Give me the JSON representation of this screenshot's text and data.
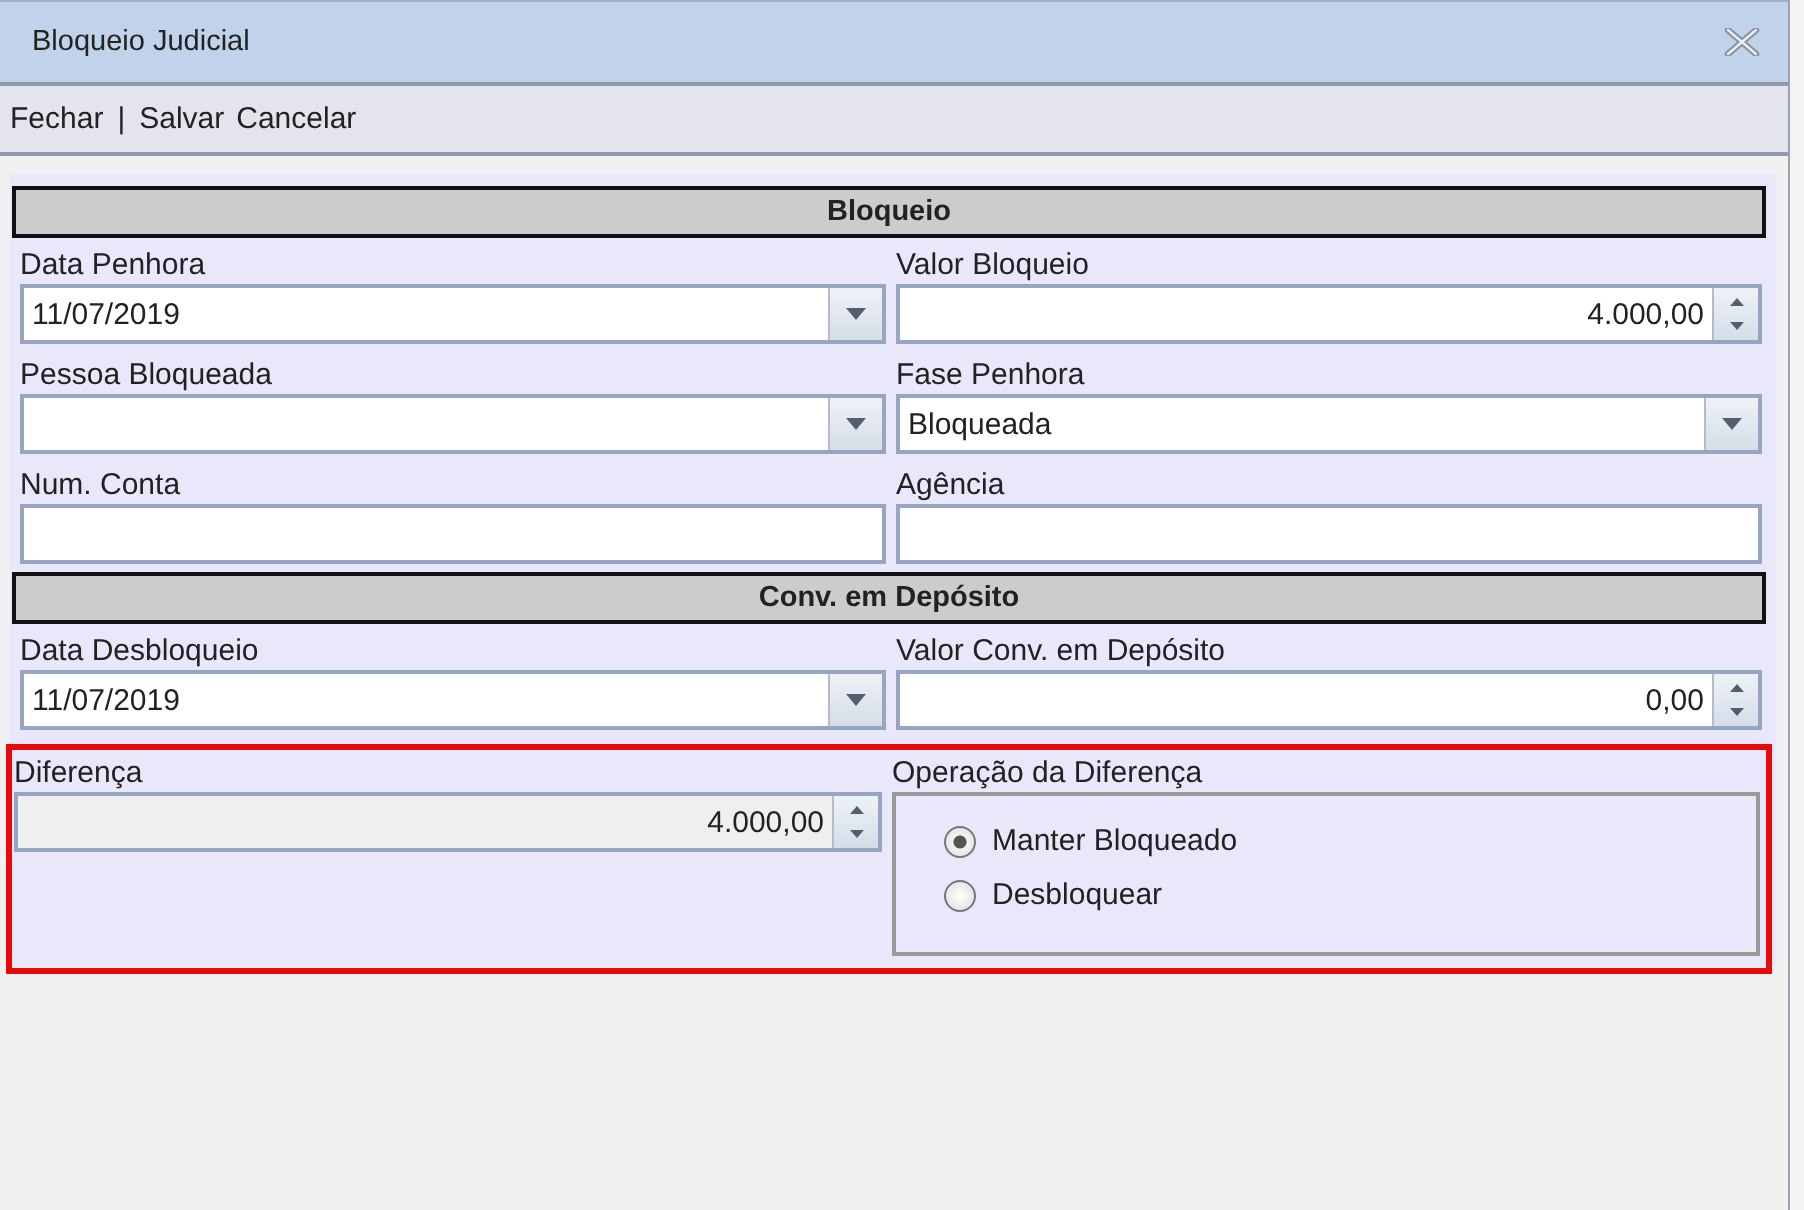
{
  "window": {
    "title": "Bloqueio Judicial"
  },
  "toolbar": [
    {
      "kind": "link",
      "label": "Fechar"
    },
    {
      "kind": "separator",
      "label": "|"
    },
    {
      "kind": "link",
      "label": "Salvar"
    },
    {
      "kind": "link",
      "label": "Cancelar"
    }
  ],
  "sections": [
    {
      "title": "Bloqueio",
      "rows": [
        {
          "highlighted": false,
          "fields": [
            {
              "label": "Data Penhora",
              "kind": "combo",
              "value": "11/07/2019",
              "disabled": false
            },
            {
              "label": "Valor Bloqueio",
              "kind": "spin",
              "value": "4.000,00",
              "disabled": false
            }
          ]
        },
        {
          "highlighted": false,
          "fields": [
            {
              "label": "Pessoa Bloqueada",
              "kind": "combo",
              "disabled": false
            },
            {
              "label": "Fase Penhora",
              "kind": "combo",
              "value": "Bloqueada",
              "disabled": false
            }
          ]
        },
        {
          "highlighted": false,
          "fields": [
            {
              "label": "Num. Conta",
              "kind": "text",
              "disabled": false
            },
            {
              "label": "Agência",
              "kind": "text",
              "disabled": false
            }
          ]
        }
      ]
    },
    {
      "title": "Conv. em Depósito",
      "rows": [
        {
          "highlighted": false,
          "fields": [
            {
              "label": "Data Desbloqueio",
              "kind": "combo",
              "value": "11/07/2019",
              "disabled": false
            },
            {
              "label": "Valor Conv. em Depósito",
              "kind": "spin",
              "value": "0,00",
              "disabled": false
            }
          ]
        },
        {
          "highlighted": true,
          "fields": [
            {
              "label": "Diferença",
              "kind": "spin",
              "value": "4.000,00",
              "disabled": true
            },
            {
              "label": "Operação da Diferença",
              "kind": "radio",
              "options": [
                {
                  "label": "Manter Bloqueado",
                  "selected": true
                },
                {
                  "label": "Desbloquear",
                  "selected": false
                }
              ]
            }
          ]
        }
      ]
    }
  ]
}
